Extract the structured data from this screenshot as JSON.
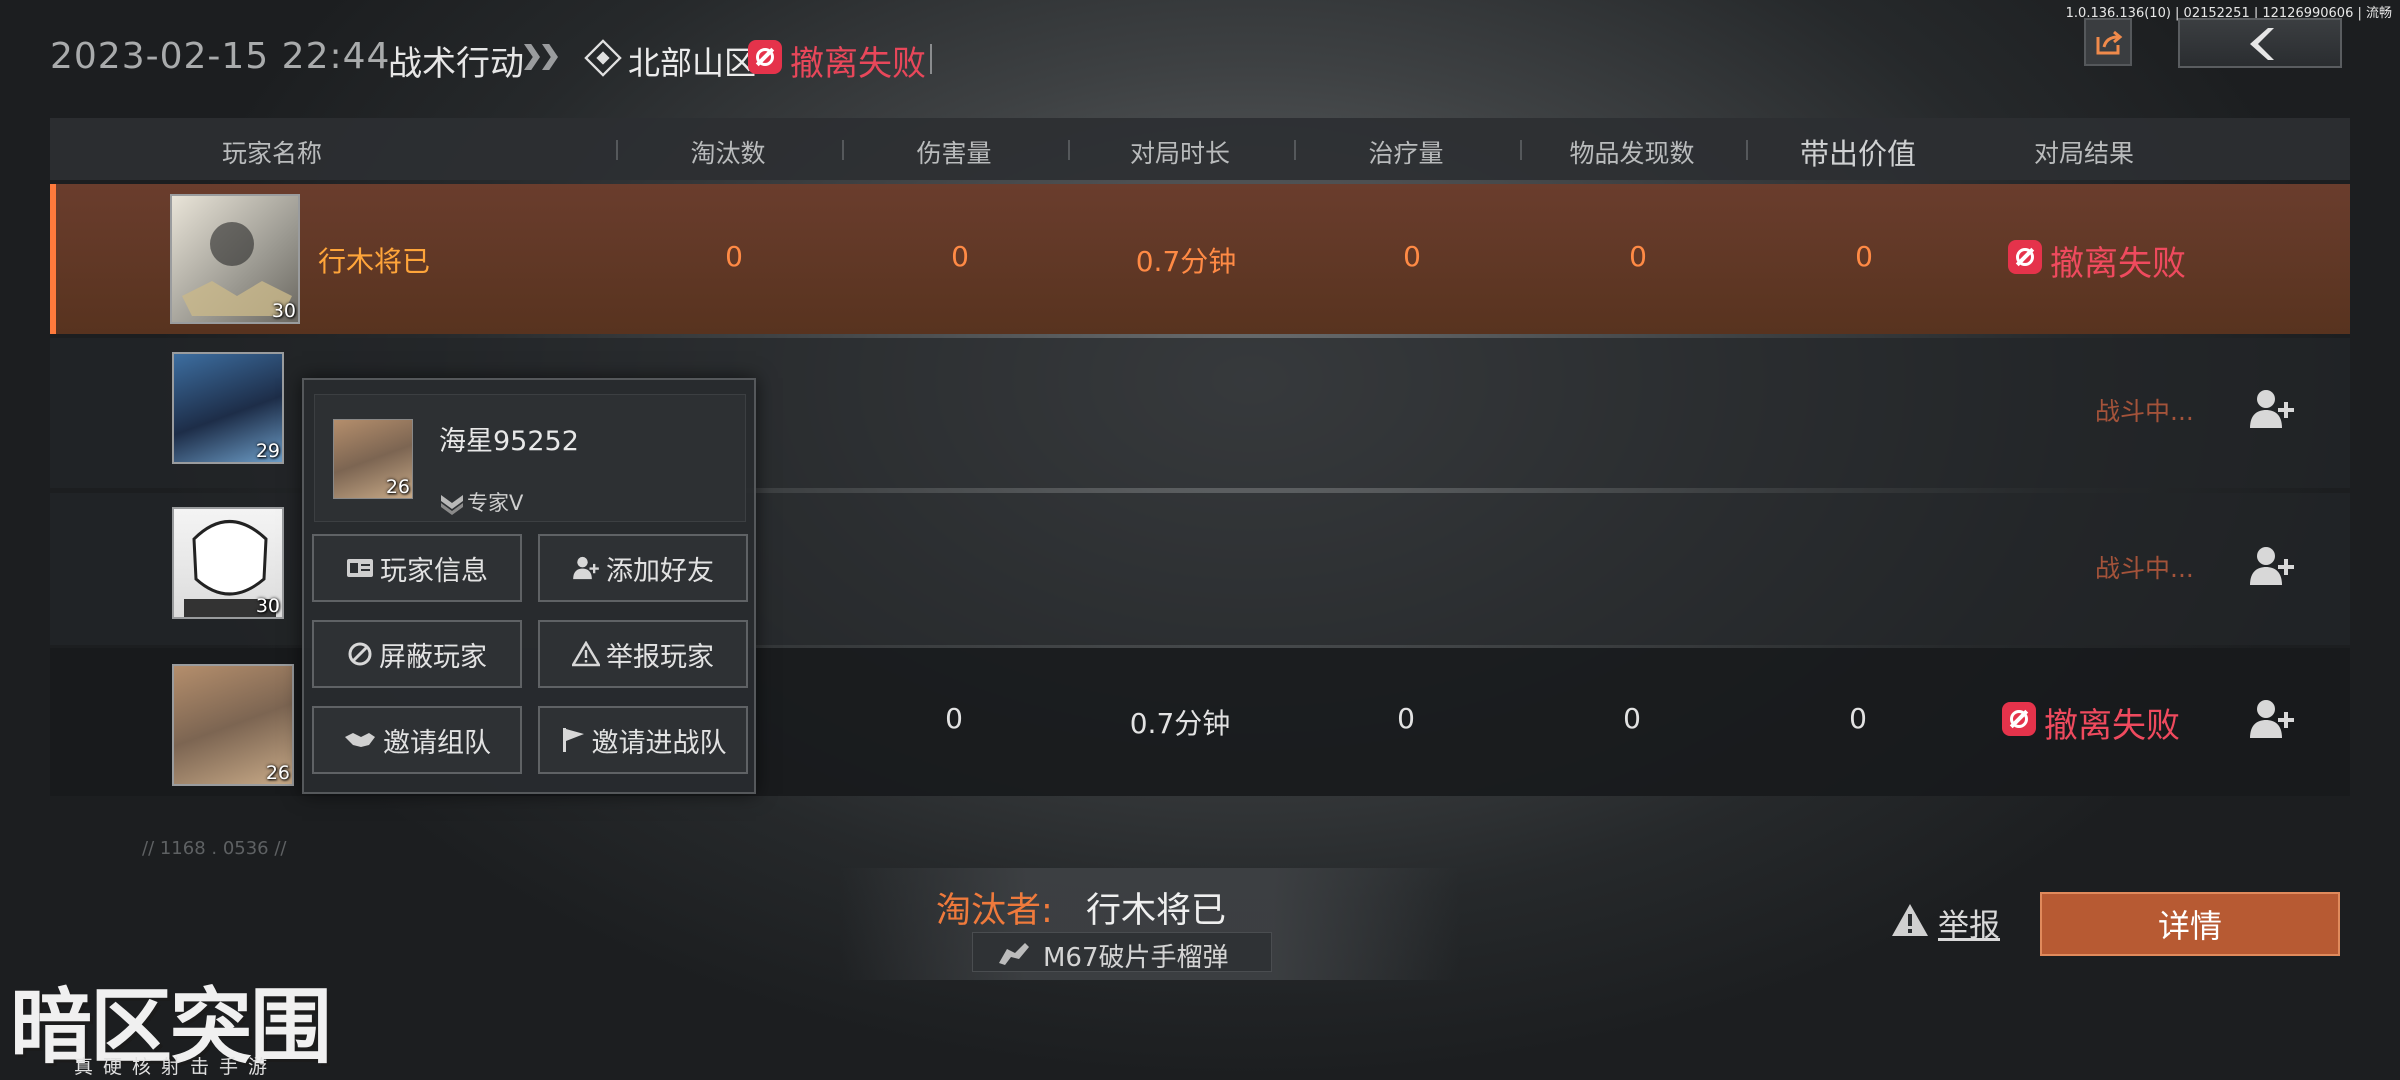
{
  "version": "1.0.136.136(10) | 02152251 | 12126990606 | 流畅",
  "header": {
    "datetime": "2023-02-15 22:44",
    "mode": "战术行动",
    "map": "北部山区",
    "result": "撤离失败"
  },
  "columns": [
    "玩家名称",
    "淘汰数",
    "伤害量",
    "对局时长",
    "治疗量",
    "物品发现数",
    "带出价值",
    "对局结果"
  ],
  "rows": [
    {
      "name": "行木将已",
      "level": "30",
      "kills": "0",
      "damage": "0",
      "duration": "0.7分钟",
      "healing": "0",
      "items": "0",
      "value": "0",
      "result": "撤离失败"
    },
    {
      "level": "29",
      "result": "战斗中..."
    },
    {
      "level": "30",
      "result": "战斗中..."
    },
    {
      "level": "26",
      "damage": "0",
      "duration": "0.7分钟",
      "healing": "0",
      "items": "0",
      "value": "0",
      "result": "撤离失败"
    }
  ],
  "popup": {
    "name": "海星95252",
    "level": "26",
    "rank": "专家V",
    "buttons": [
      "玩家信息",
      "添加好友",
      "屏蔽玩家",
      "举报玩家",
      "邀请组队",
      "邀请进战队"
    ]
  },
  "killer": {
    "label": "淘汰者:",
    "name": "行木将已",
    "weapon": "M67破片手榴弹"
  },
  "report_label": "举报",
  "detail_label": "详情",
  "coord_text": "// 1168 . 0536 //",
  "logo": {
    "main": "暗区突围",
    "sub": "真硬核射击手游"
  },
  "colors": {
    "accent": "#ff7a3c",
    "fail": "#e5334b",
    "detail": "#b75a33"
  }
}
